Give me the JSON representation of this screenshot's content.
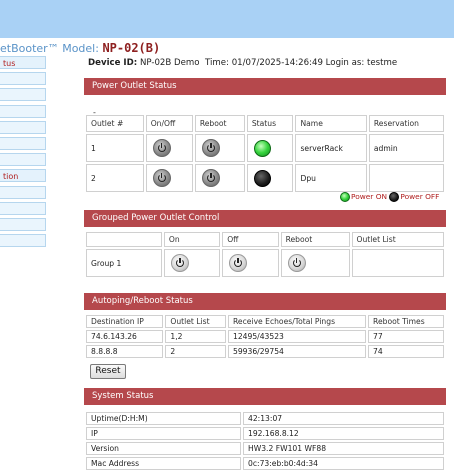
{
  "brand": {
    "product": "etBooter™",
    "model_label": "Model:",
    "model_value": "NP-02(B)"
  },
  "sidebar": {
    "items": [
      "tus",
      "",
      "",
      "",
      "",
      "",
      "",
      "tion",
      "",
      "",
      "",
      ""
    ]
  },
  "device": {
    "id_label": "Device ID:",
    "id_value": "NP-02B Demo",
    "time_label": "Time:",
    "time_value": "01/07/2025-14:26:49",
    "login_label": "Login as:",
    "login_value": "testme"
  },
  "power_outlet": {
    "title": "Power Outlet Status",
    "dash": "-",
    "headers": [
      "Outlet #",
      "On/Off",
      "Reboot",
      "Status",
      "Name",
      "Reservation"
    ],
    "rows": [
      {
        "outlet": "1",
        "status": "on",
        "name": "serverRack",
        "reservation": "admin"
      },
      {
        "outlet": "2",
        "status": "off",
        "name": "Dpu",
        "reservation": ""
      }
    ],
    "legend_on": "Power ON",
    "legend_off": "Power OFF"
  },
  "grouped": {
    "title": "Grouped Power Outlet Control",
    "headers": [
      "",
      "On",
      "Off",
      "Reboot",
      "Outlet List"
    ],
    "rows": [
      {
        "group": "Group 1",
        "outlet_list": ""
      }
    ]
  },
  "autoping": {
    "title": "Autoping/Reboot Status",
    "headers": [
      "Destination IP",
      "Outlet List",
      "Receive Echoes/Total Pings",
      "Reboot Times"
    ],
    "rows": [
      {
        "ip": "74.6.143.26",
        "outlets": "1,2",
        "echoes": "12495/43523",
        "reboots": "77"
      },
      {
        "ip": "8.8.8.8",
        "outlets": "2",
        "echoes": "59936/29754",
        "reboots": "74"
      }
    ],
    "reset_label": "Reset"
  },
  "system": {
    "title": "System Status",
    "rows": [
      {
        "label": "Uptime(D:H:M)",
        "value": "42:13:07"
      },
      {
        "label": "IP",
        "value": "192.168.8.12"
      },
      {
        "label": "Version",
        "value": "HW3.2 FW101 WF88"
      },
      {
        "label": "Mac Address",
        "value": "0c:73:eb:b0:4d:34"
      }
    ]
  },
  "colors": {
    "header_bg": "#b5484c",
    "topbar": "#a9d1f5",
    "sidebar_text": "#b02020",
    "model_value": "#8e2020",
    "brand": "#5a93c8"
  }
}
